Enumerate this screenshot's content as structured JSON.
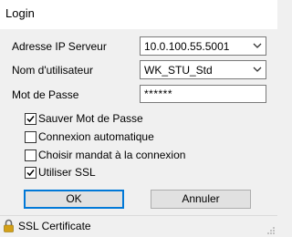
{
  "window": {
    "title": "Login"
  },
  "form": {
    "server_ip": {
      "label": "Adresse IP Serveur",
      "value": "10.0.100.55.5001"
    },
    "username": {
      "label": "Nom d'utilisateur",
      "value": "WK_STU_Std"
    },
    "password": {
      "label": "Mot de Passe",
      "value": "******"
    }
  },
  "options": [
    {
      "label": "Sauver Mot de Passe",
      "checked": true
    },
    {
      "label": "Connexion automatique",
      "checked": false
    },
    {
      "label": "Choisir mandat à la connexion",
      "checked": false
    },
    {
      "label": "Utiliser SSL",
      "checked": true
    }
  ],
  "buttons": {
    "ok": "OK",
    "cancel": "Annuler"
  },
  "statusbar": {
    "icon": "lock-icon",
    "text": "SSL Certificate",
    "icon_color": "#d4a017"
  },
  "colors": {
    "focus_border": "#0078d7",
    "background": "#f0f0f0"
  }
}
